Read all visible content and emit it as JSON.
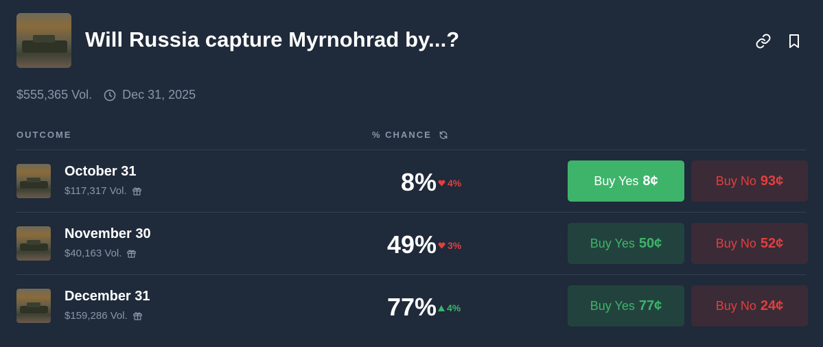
{
  "market": {
    "title": "Will Russia capture Myrnohrad by...?",
    "volume": "$555,365 Vol.",
    "end_date": "Dec 31, 2025"
  },
  "columns": {
    "outcome": "OUTCOME",
    "chance": "% CHANCE"
  },
  "outcomes": [
    {
      "label": "October 31",
      "volume": "$117,317 Vol.",
      "chance": "8%",
      "delta": "4%",
      "delta_direction": "down",
      "buy_yes_label": "Buy Yes",
      "buy_yes_price": "8¢",
      "buy_no_label": "Buy No",
      "buy_no_price": "93¢"
    },
    {
      "label": "November 30",
      "volume": "$40,163 Vol.",
      "chance": "49%",
      "delta": "3%",
      "delta_direction": "down",
      "buy_yes_label": "Buy Yes",
      "buy_yes_price": "50¢",
      "buy_no_label": "Buy No",
      "buy_no_price": "52¢"
    },
    {
      "label": "December 31",
      "volume": "$159,286 Vol.",
      "chance": "77%",
      "delta": "4%",
      "delta_direction": "up",
      "buy_yes_label": "Buy Yes",
      "buy_yes_price": "77¢",
      "buy_no_label": "Buy No",
      "buy_no_price": "24¢"
    }
  ],
  "colors": {
    "background": "#1f2a3a",
    "yes_green": "#3eb46b",
    "no_red": "#e23f3f",
    "muted_text": "#8a97a8"
  },
  "icons": {
    "header": [
      "link-icon",
      "bookmark-icon"
    ],
    "meta": "clock-icon",
    "chance_header": "refresh-icon",
    "volume": "gift-icon",
    "delta_up": "triangle-up-icon",
    "delta_down": "heart-down-icon"
  }
}
